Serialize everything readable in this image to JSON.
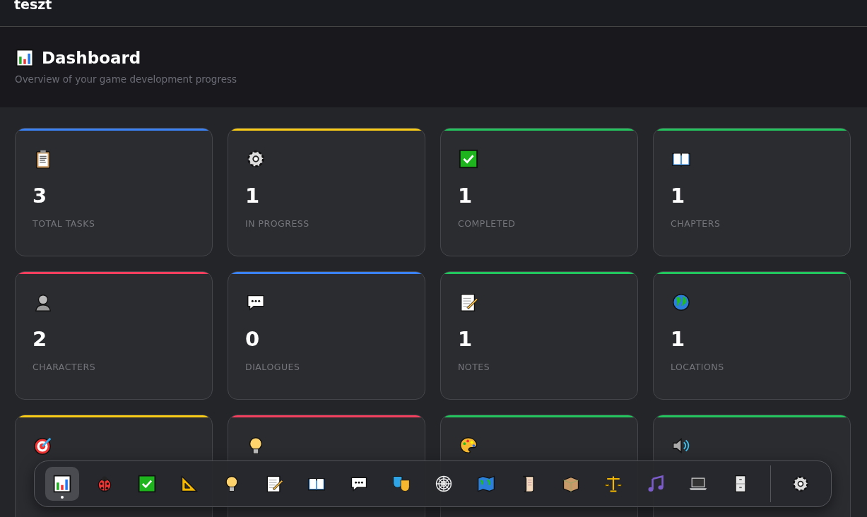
{
  "app_bar": {
    "title": "teszt"
  },
  "header": {
    "title": "Dashboard",
    "subtitle": "Overview of your game development progress"
  },
  "cards": [
    {
      "value": "3",
      "label": "TOTAL TASKS",
      "color": "#3b82f6"
    },
    {
      "value": "1",
      "label": "IN PROGRESS",
      "color": "#facc15"
    },
    {
      "value": "1",
      "label": "COMPLETED",
      "color": "#22c55e"
    },
    {
      "value": "1",
      "label": "CHAPTERS",
      "color": "#22c55e"
    },
    {
      "value": "2",
      "label": "CHARACTERS",
      "color": "#f43f5e"
    },
    {
      "value": "0",
      "label": "DIALOGUES",
      "color": "#3b82f6"
    },
    {
      "value": "1",
      "label": "NOTES",
      "color": "#22c55e"
    },
    {
      "value": "1",
      "label": "LOCATIONS",
      "color": "#22c55e"
    },
    {
      "color": "#facc15"
    },
    {
      "color": "#f43f5e"
    },
    {
      "color": "#22c55e"
    },
    {
      "color": "#22c55e"
    }
  ],
  "dock": {
    "items": [
      {
        "selected": true
      },
      {
        "selected": false
      },
      {
        "selected": false
      },
      {
        "selected": false
      },
      {
        "selected": false
      },
      {
        "selected": false
      },
      {
        "selected": false
      },
      {
        "selected": false
      },
      {
        "selected": false
      },
      {
        "selected": false
      },
      {
        "selected": false
      },
      {
        "selected": false
      },
      {
        "selected": false
      },
      {
        "selected": false
      },
      {
        "selected": false
      },
      {
        "selected": false
      },
      {
        "selected": false
      }
    ],
    "settings": {
      "selected": false
    }
  }
}
